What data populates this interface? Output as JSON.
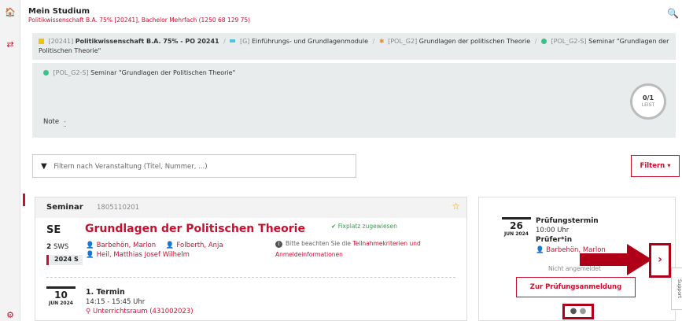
{
  "header": {
    "title": "Mein Studium",
    "subtitle": "Politikwissenschaft B.A. 75% [20241], Bachelor Mehrfach (1250 68 129 75)"
  },
  "breadcrumb": {
    "c1_code": "[20241]",
    "c1_name": "Politikwissenschaft B.A. 75% - PO 20241",
    "c2_code": "[G]",
    "c2_name": "Einführungs- und Grundlagenmodule",
    "c3_code": "[POL_G2]",
    "c3_name": "Grundlagen der politischen Theorie",
    "c4_code": "[POL_G2-S]",
    "c4_name": "Seminar \"Grundlagen der Politischen Theorie\"",
    "sep": "/",
    "colors": {
      "c1": "#f2c200",
      "c2": "#4fc3dd",
      "c3": "#f08a24",
      "c4": "#3cc08a"
    }
  },
  "module": {
    "code": "[POL_G2-S]",
    "name": "Seminar \"Grundlagen der Politischen Theorie\"",
    "note_label": "Note",
    "note_value": "-",
    "progress_value": "0/1",
    "progress_label": "LEIST"
  },
  "filter": {
    "placeholder": "Filtern nach Veranstaltung (Titel, Nummer, ...)",
    "button_label": "Filtern ▾"
  },
  "course": {
    "type": "Seminar",
    "number": "1805110201",
    "short_type": "SE",
    "sws_value": "2",
    "sws_unit": "SWS",
    "semester": "2024 S",
    "title": "Grundlagen der Politischen Theorie",
    "lecturer1": "Barbehön, Marlon",
    "lecturer2": "Folberth, Anja",
    "lecturer3": "Heil, Matthias Josef Wilhelm",
    "fixplatz": "Fixplatz zugewiesen",
    "hint_prefix": "Bitte beachten Sie die",
    "hint_link": "Teilnahmekriterien und Anmeldeinformationen",
    "term_day": "10",
    "term_month": "JUN 2024",
    "term_label": "1. Termin",
    "term_time": "14:15 - 15:45 Uhr",
    "term_room": "Unterrichtsraum (431002023)"
  },
  "exam": {
    "day": "26",
    "month": "JUN 2024",
    "label": "Prüfungstermin",
    "time": "10:00 Uhr",
    "examiner_label": "Prüfer*in",
    "examiner": "Barbehön, Marlon",
    "status": "Nicht angemeldet",
    "button_label": "Zur Prüfungsanmeldung"
  },
  "support_label": "Support"
}
